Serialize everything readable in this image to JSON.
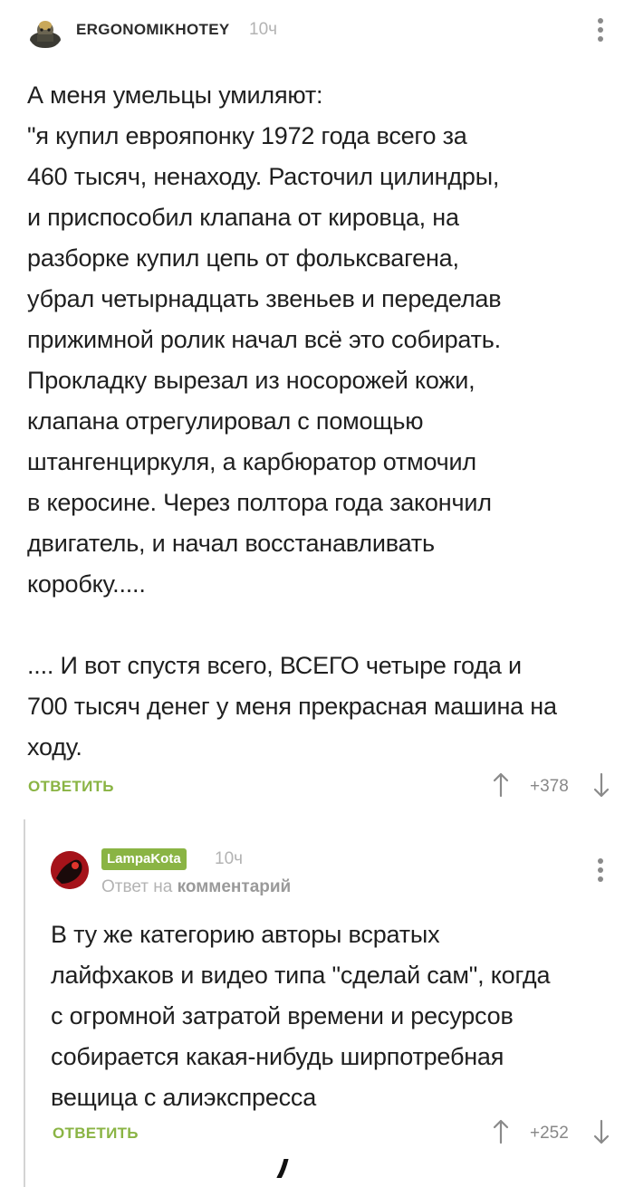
{
  "comments": [
    {
      "author": "ERGONOMIKHOTEY",
      "time": "10ч",
      "text": "А меня умельцы умиляют:\n\"я купил евро­японку 1972 года всего за\n460 тысяч, ненаходу. Расточил цилиндры,\nи приспособил клапана от кировца, на\nразборке купил цепь от фольксвагена,\nубрал четырнадцать звеньев и переделав\nприжимной ролик начал всё это собирать.\nПрокладку вырезал из носорожей кожи,\nклапана отрегулировал с помощью\nштангенциркуля, а карбюратор отмочил\nв керосине. Через полтора года закончил\nдвигатель, и начал восстанавливать\nкоробку.....\n\n.... И вот спустя всего, ВСЕГО четыре года и\n700 тысяч денег у меня прекрасная машина на\nходу.",
      "reply_label": "ОТВЕТИТЬ",
      "rating": "+378"
    },
    {
      "author": "LampaKota",
      "time": "10ч",
      "reply_to_prefix": "Ответ на",
      "reply_to_target": "комментарий",
      "text": "В ту же категорию авторы всратых\nлайфхаков и видео типа \"сделай сам\", когда\nс огромной затратой времени и ресурсов\nсобирается какая-нибудь ширпотребная\nвещица с алиэкспресса",
      "reply_label": "ОТВЕТИТЬ",
      "rating": "+252"
    }
  ],
  "colors": {
    "accent": "#8ab444",
    "muted": "#b3b3b3",
    "text": "#1f1f1f"
  },
  "icons": [
    "avatar",
    "more-vertical-icon",
    "arrow-up-icon",
    "arrow-down-icon"
  ]
}
